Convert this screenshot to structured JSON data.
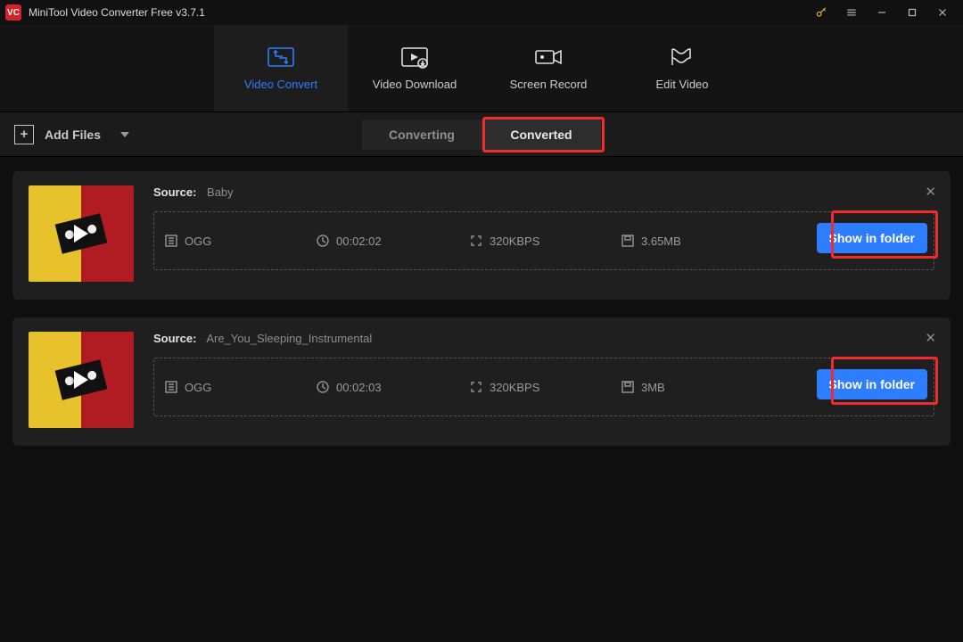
{
  "title": "MiniTool Video Converter Free v3.7.1",
  "app_icon_text": "VC",
  "nav": [
    {
      "label": "Video Convert",
      "icon": "convert",
      "active": true
    },
    {
      "label": "Video Download",
      "icon": "download",
      "active": false
    },
    {
      "label": "Screen Record",
      "icon": "record",
      "active": false
    },
    {
      "label": "Edit Video",
      "icon": "edit",
      "active": false
    }
  ],
  "toolbar": {
    "add_files_label": "Add Files",
    "seg": {
      "converting": "Converting",
      "converted": "Converted",
      "active": "converted"
    }
  },
  "source_prefix": "Source:",
  "show_btn": "Show in folder",
  "items": [
    {
      "source": "Baby",
      "format": "OGG",
      "duration": "00:02:02",
      "bitrate": "320KBPS",
      "size": "3.65MB"
    },
    {
      "source": "Are_You_Sleeping_Instrumental",
      "format": "OGG",
      "duration": "00:02:03",
      "bitrate": "320KBPS",
      "size": "3MB"
    }
  ]
}
